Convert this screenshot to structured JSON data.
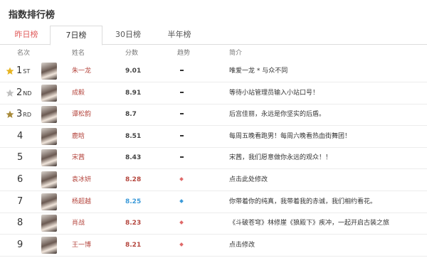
{
  "page": {
    "title": "指数排行榜"
  },
  "tabs": [
    {
      "label": "昨日榜"
    },
    {
      "label": "7日榜"
    },
    {
      "label": "30日榜"
    },
    {
      "label": "半年榜"
    }
  ],
  "table": {
    "headers": [
      "名次",
      "姓名",
      "分数",
      "趋势",
      "简介"
    ],
    "rows": [
      {
        "rank": "1",
        "suffix": "ST",
        "name": "朱一龙",
        "score": "9.01",
        "trend": "flat",
        "intro": "唯爱一龙 * 与众不同",
        "star": "gold"
      },
      {
        "rank": "2",
        "suffix": "ND",
        "name": "成毅",
        "score": "8.91",
        "trend": "flat",
        "intro": "等待小站管理员输入小站口号！",
        "star": "silver"
      },
      {
        "rank": "3",
        "suffix": "RD",
        "name": "谭松韵",
        "score": "8.7",
        "trend": "flat",
        "intro": "后宫佳丽，永远是你坚实的后盾。",
        "star": "bronze"
      },
      {
        "rank": "4",
        "suffix": "",
        "name": "鹿晗",
        "score": "8.51",
        "trend": "flat",
        "intro": "每周五晚看跑男！每周六晚看热血街舞团！"
      },
      {
        "rank": "5",
        "suffix": "",
        "name": "宋茜",
        "score": "8.43",
        "trend": "flat",
        "intro": "宋茜，我们愿意做你永远的观众！！"
      },
      {
        "rank": "6",
        "suffix": "",
        "name": "袁冰妍",
        "score": "8.28",
        "trend": "up",
        "intro": "点击此处修改"
      },
      {
        "rank": "7",
        "suffix": "",
        "name": "杨超越",
        "score": "8.25",
        "trend": "down",
        "intro": "你带着你的纯真，我带着我的赤诚，我们相约看花。"
      },
      {
        "rank": "8",
        "suffix": "",
        "name": "肖战",
        "score": "8.23",
        "trend": "up",
        "intro": "《斗破苍穹》林修崖《狼殿下》疾冲，一起开启古装之旅"
      },
      {
        "rank": "9",
        "suffix": "",
        "name": "王一博",
        "score": "8.21",
        "trend": "up",
        "intro": "点击修改"
      }
    ]
  },
  "colors": {
    "gold": "#e6b422",
    "silver": "#c0c0c0",
    "bronze": "#a88a3a",
    "up_score": "#b5473f",
    "down_score": "#3b9ad9",
    "name": "#b5473f"
  }
}
